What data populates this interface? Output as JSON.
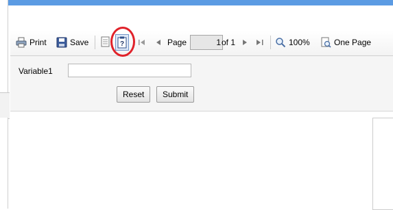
{
  "toolbar": {
    "print_label": "Print",
    "save_label": "Save",
    "page_label": "Page",
    "page_value": "1",
    "of_label": "of 1",
    "zoom_label": "100%",
    "view_label": "One Page"
  },
  "params": {
    "variable_label": "Variable1",
    "variable_value": "",
    "reset_label": "Reset",
    "submit_label": "Submit"
  },
  "colors": {
    "header_bar": "#5b9be3",
    "highlight_circle": "#e0222a"
  },
  "icons": [
    "printer-icon",
    "floppy-disk-icon",
    "document-icon",
    "clipboard-question-icon",
    "first-page-icon",
    "previous-page-icon",
    "next-page-icon",
    "last-page-icon",
    "magnifier-icon",
    "page-view-icon"
  ]
}
